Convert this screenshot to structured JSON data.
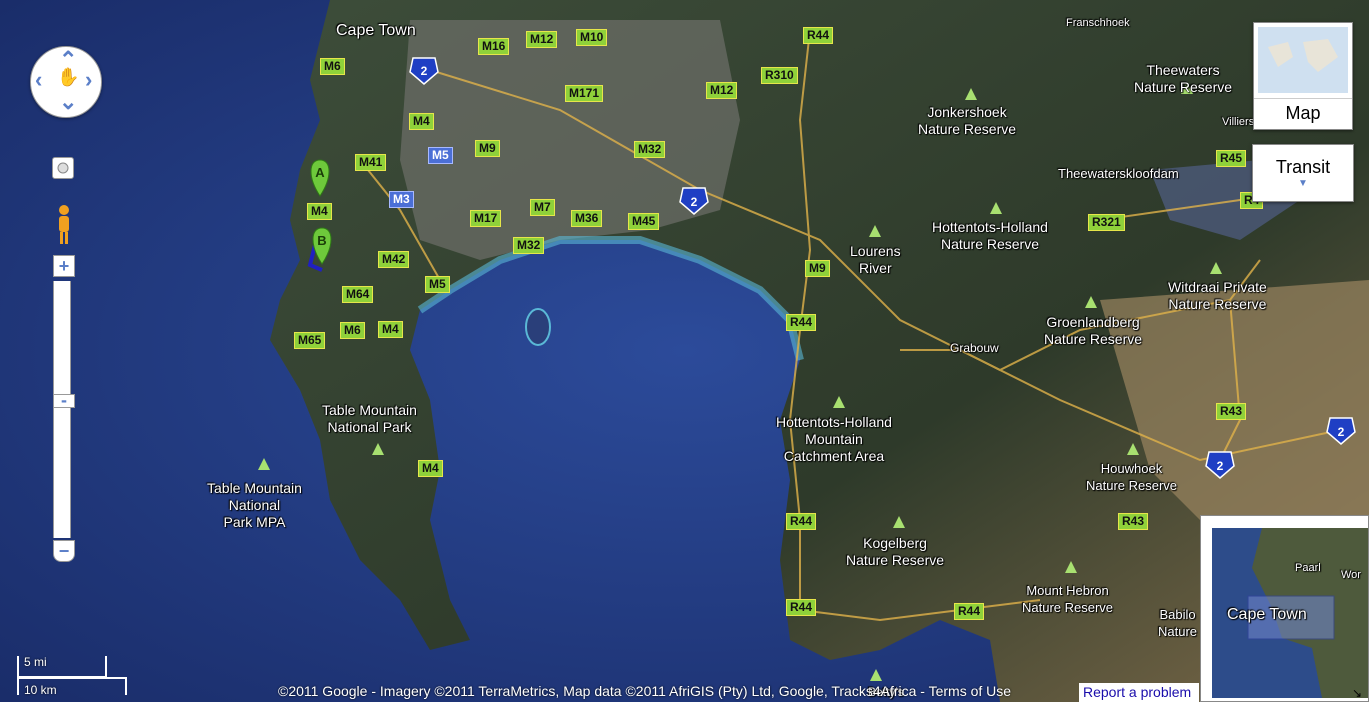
{
  "map_type_buttons": {
    "map": "Map",
    "transit": "Transit"
  },
  "scale": {
    "miles": "5 mi",
    "km": "10 km"
  },
  "attribution": "©2011 Google - Imagery ©2011 TerraMetrics, Map data ©2011 AfriGIS (Pty) Ltd, Google, Tracks4Africa - Terms of Use",
  "report_link": "Report a problem",
  "markers": {
    "a": "A",
    "b": "B"
  },
  "places": {
    "cape_town": "Cape Town",
    "franschhoek": "Franschhoek",
    "theewaters": "Theewaters\nNature Reserve",
    "villiers": "Villiers",
    "jonkershoek": "Jonkershoek\nNature Reserve",
    "theewaterskloofdam": "Theewaterskloofdam",
    "hottentots_holland_nr": "Hottentots-Holland\nNature Reserve",
    "lourens_river": "Lourens\nRiver",
    "witdraai": "Witdraai Private\nNature Reserve",
    "groenlandberg": "Groenlandberg\nNature Reserve",
    "grabouw": "Grabouw",
    "table_mountain_np": "Table Mountain\nNational Park",
    "table_mountain_mpa": "Table Mountain\nNational\nPark MPA",
    "hh_mountain_catchment": "Hottentots-Holland\nMountain\nCatchment Area",
    "houwhoek": "Houwhoek\nNature Reserve",
    "kogelberg": "Kogelberg\nNature Reserve",
    "mount_hebron": "Mount Hebron\nNature Reserve",
    "babilonstoring": "Babilo\nNature",
    "betty": "Betty's"
  },
  "roads": [
    {
      "id": "M6a",
      "t": "M6"
    },
    {
      "id": "M16",
      "t": "M16"
    },
    {
      "id": "M12a",
      "t": "M12"
    },
    {
      "id": "M10",
      "t": "M10"
    },
    {
      "id": "R44a",
      "t": "R44"
    },
    {
      "id": "R310",
      "t": "R310"
    },
    {
      "id": "M12b",
      "t": "M12"
    },
    {
      "id": "M171",
      "t": "M171"
    },
    {
      "id": "M4a",
      "t": "M4"
    },
    {
      "id": "M5a",
      "t": "M5"
    },
    {
      "id": "M9a",
      "t": "M9"
    },
    {
      "id": "M32a",
      "t": "M32"
    },
    {
      "id": "M41",
      "t": "M41"
    },
    {
      "id": "M3",
      "t": "M3"
    },
    {
      "id": "M4b",
      "t": "M4"
    },
    {
      "id": "M17",
      "t": "M17"
    },
    {
      "id": "M7",
      "t": "M7"
    },
    {
      "id": "M36",
      "t": "M36"
    },
    {
      "id": "M45",
      "t": "M45"
    },
    {
      "id": "M32b",
      "t": "M32"
    },
    {
      "id": "M42",
      "t": "M42"
    },
    {
      "id": "M5b",
      "t": "M5"
    },
    {
      "id": "M64",
      "t": "M64"
    },
    {
      "id": "M6b",
      "t": "M6"
    },
    {
      "id": "M4c",
      "t": "M4"
    },
    {
      "id": "M65",
      "t": "M65"
    },
    {
      "id": "M9b",
      "t": "M9"
    },
    {
      "id": "R44b",
      "t": "R44"
    },
    {
      "id": "M4d",
      "t": "M4"
    },
    {
      "id": "R44c",
      "t": "R44"
    },
    {
      "id": "R44d",
      "t": "R44"
    },
    {
      "id": "R44e",
      "t": "R44"
    },
    {
      "id": "R45",
      "t": "R45"
    },
    {
      "id": "R321",
      "t": "R321"
    },
    {
      "id": "R43a",
      "t": "R43"
    },
    {
      "id": "R43b",
      "t": "R43"
    },
    {
      "id": "R4x",
      "t": "R4"
    }
  ],
  "shields": {
    "n2": "2"
  },
  "overview": {
    "cape_town": "Cape Town",
    "paarl": "Paarl",
    "worcester": "Wor"
  }
}
